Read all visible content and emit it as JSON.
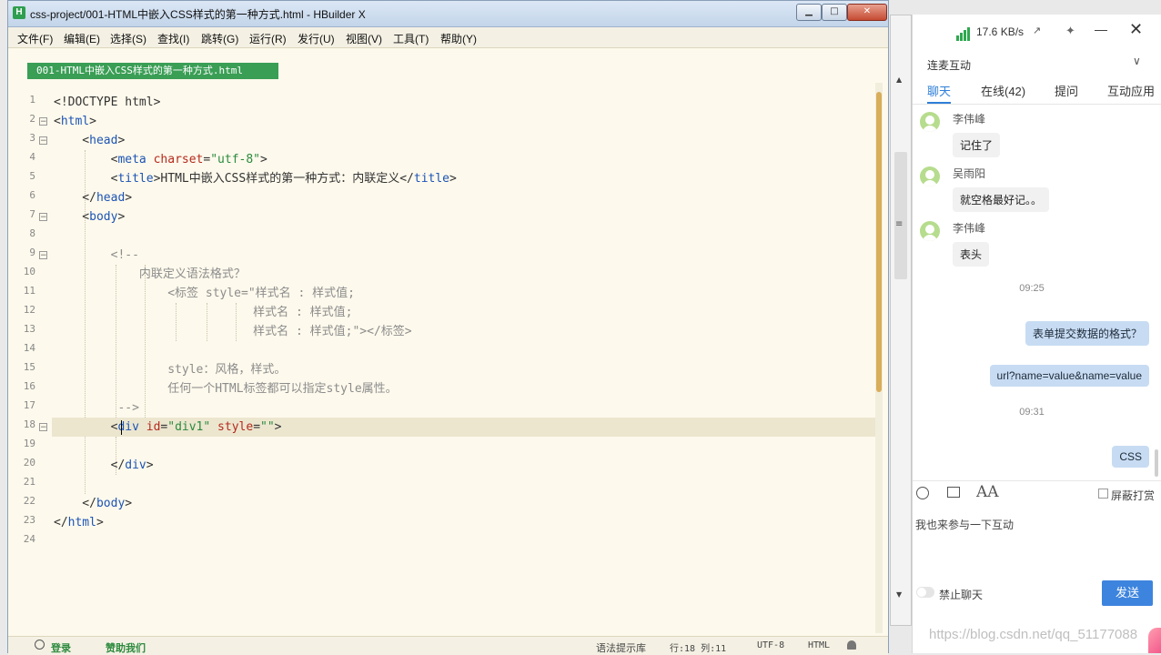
{
  "editor": {
    "title": "css-project/001-HTML中嵌入CSS样式的第一种方式.html - HBuilder X",
    "logo_letter": "H",
    "window_buttons": {
      "minimize": "▁",
      "maximize": "□",
      "close": "✕"
    },
    "menu": [
      "文件(F)",
      "编辑(E)",
      "选择(S)",
      "查找(I)",
      "跳转(G)",
      "运行(R)",
      "发行(U)",
      "视图(V)",
      "工具(T)",
      "帮助(Y)"
    ],
    "file_tab": "001-HTML中嵌入CSS样式的第一种方式.html",
    "current_line": 18,
    "lines": [
      {
        "n": "1",
        "fold": "",
        "tokens": [
          [
            "p",
            "<!DOCTYPE html>"
          ]
        ]
      },
      {
        "n": "2",
        "fold": "⊟",
        "tokens": [
          [
            "p",
            "<"
          ],
          [
            "t",
            "html"
          ],
          [
            "p",
            ">"
          ]
        ]
      },
      {
        "n": "3",
        "fold": "⊟",
        "tokens": [
          [
            "p",
            "    <"
          ],
          [
            "t",
            "head"
          ],
          [
            "p",
            ">"
          ]
        ]
      },
      {
        "n": "4",
        "fold": "",
        "tokens": [
          [
            "p",
            "        <"
          ],
          [
            "t",
            "meta "
          ],
          [
            "a",
            "charset"
          ],
          [
            "p",
            "="
          ],
          [
            "s",
            "\"utf-8\""
          ],
          [
            "p",
            ">"
          ]
        ]
      },
      {
        "n": "5",
        "fold": "",
        "tokens": [
          [
            "p",
            "        <"
          ],
          [
            "t",
            "title"
          ],
          [
            "p",
            ">HTML中嵌入CSS样式的第一种方式：内联定义</"
          ],
          [
            "t",
            "title"
          ],
          [
            "p",
            ">"
          ]
        ]
      },
      {
        "n": "6",
        "fold": "",
        "tokens": [
          [
            "p",
            "    </"
          ],
          [
            "t",
            "head"
          ],
          [
            "p",
            ">"
          ]
        ]
      },
      {
        "n": "7",
        "fold": "⊟",
        "tokens": [
          [
            "p",
            "    <"
          ],
          [
            "t",
            "body"
          ],
          [
            "p",
            ">"
          ]
        ]
      },
      {
        "n": "8",
        "fold": "",
        "tokens": []
      },
      {
        "n": "9",
        "fold": "⊟",
        "tokens": [
          [
            "c",
            "        <!--"
          ]
        ]
      },
      {
        "n": "10",
        "fold": "",
        "tokens": [
          [
            "c",
            "            内联定义语法格式？"
          ]
        ]
      },
      {
        "n": "11",
        "fold": "",
        "tokens": [
          [
            "c",
            "                <标签 style=\"样式名 : 样式值;"
          ]
        ]
      },
      {
        "n": "12",
        "fold": "",
        "tokens": [
          [
            "c",
            "                            样式名 : 样式值;"
          ]
        ]
      },
      {
        "n": "13",
        "fold": "",
        "tokens": [
          [
            "c",
            "                            样式名 : 样式值;\"></标签>"
          ]
        ]
      },
      {
        "n": "14",
        "fold": "",
        "tokens": []
      },
      {
        "n": "15",
        "fold": "",
        "tokens": [
          [
            "c",
            "                style：风格，样式。"
          ]
        ]
      },
      {
        "n": "16",
        "fold": "",
        "tokens": [
          [
            "c",
            "                任何一个HTML标签都可以指定style属性。"
          ]
        ]
      },
      {
        "n": "17",
        "fold": "",
        "tokens": [
          [
            "c",
            "         -->"
          ]
        ]
      },
      {
        "n": "18",
        "fold": "⊟",
        "tokens": [
          [
            "p",
            "        <"
          ],
          [
            "t",
            "div "
          ],
          [
            "a",
            "id"
          ],
          [
            "p",
            "="
          ],
          [
            "s",
            "\"div1\""
          ],
          [
            "p",
            " "
          ],
          [
            "a",
            "style"
          ],
          [
            "p",
            "="
          ],
          [
            "s",
            "\"\""
          ],
          [
            "p",
            ">"
          ]
        ]
      },
      {
        "n": "19",
        "fold": "",
        "tokens": []
      },
      {
        "n": "20",
        "fold": "",
        "tokens": [
          [
            "p",
            "        </"
          ],
          [
            "t",
            "div"
          ],
          [
            "p",
            ">"
          ]
        ]
      },
      {
        "n": "21",
        "fold": "",
        "tokens": []
      },
      {
        "n": "22",
        "fold": "",
        "tokens": [
          [
            "p",
            "    </"
          ],
          [
            "t",
            "body"
          ],
          [
            "p",
            ">"
          ]
        ]
      },
      {
        "n": "23",
        "fold": "",
        "tokens": [
          [
            "p",
            "</"
          ],
          [
            "t",
            "html"
          ],
          [
            "p",
            ">"
          ]
        ]
      },
      {
        "n": "24",
        "fold": "",
        "tokens": []
      }
    ],
    "status": {
      "login": "登录",
      "sponsor": "赞助我们",
      "syntax_hint": "语法提示库",
      "position": "行:18  列:11",
      "encoding": "UTF-8",
      "language": "HTML"
    }
  },
  "chat": {
    "net_speed": "17.6 KB/s",
    "icons": {
      "expand": "↗",
      "pin": "✦",
      "minimize": "—",
      "close": "✕"
    },
    "section_title": "连麦互动",
    "section_chevron": "∨",
    "tabs": [
      "聊天",
      "在线(42)",
      "提问",
      "互动应用"
    ],
    "messages": [
      {
        "name": "李伟峰",
        "text": "记住了"
      },
      {
        "name": "吴雨阳",
        "text": "就空格最好记。。"
      },
      {
        "name": "李伟峰",
        "text": "表头"
      }
    ],
    "time_1": "09:25",
    "my_messages": [
      "表单提交数据的格式？",
      "url?name=value&name=value"
    ],
    "time_2": "09:31",
    "my_last_message": "CSS",
    "font_icon_label": "AA",
    "block_label": "屏蔽打赏",
    "input_text": "我也来参与一下互动",
    "mute_label": "禁止聊天",
    "send_label": "发送"
  },
  "side_strip": {
    "up": "▲",
    "down": "▼",
    "grip": "≡"
  },
  "watermark": "https://blog.csdn.net/qq_51177088",
  "colors": {
    "editor_bg": "#fdf9ec",
    "tab_green": "#3a9e55",
    "tag_blue": "#1c54b5",
    "attr_red": "#b52a1d",
    "string_green": "#2b8a3e",
    "comment_gray": "#8c8c8c",
    "accent_blue": "#2f7fd8",
    "send_blue": "#3d84de"
  }
}
